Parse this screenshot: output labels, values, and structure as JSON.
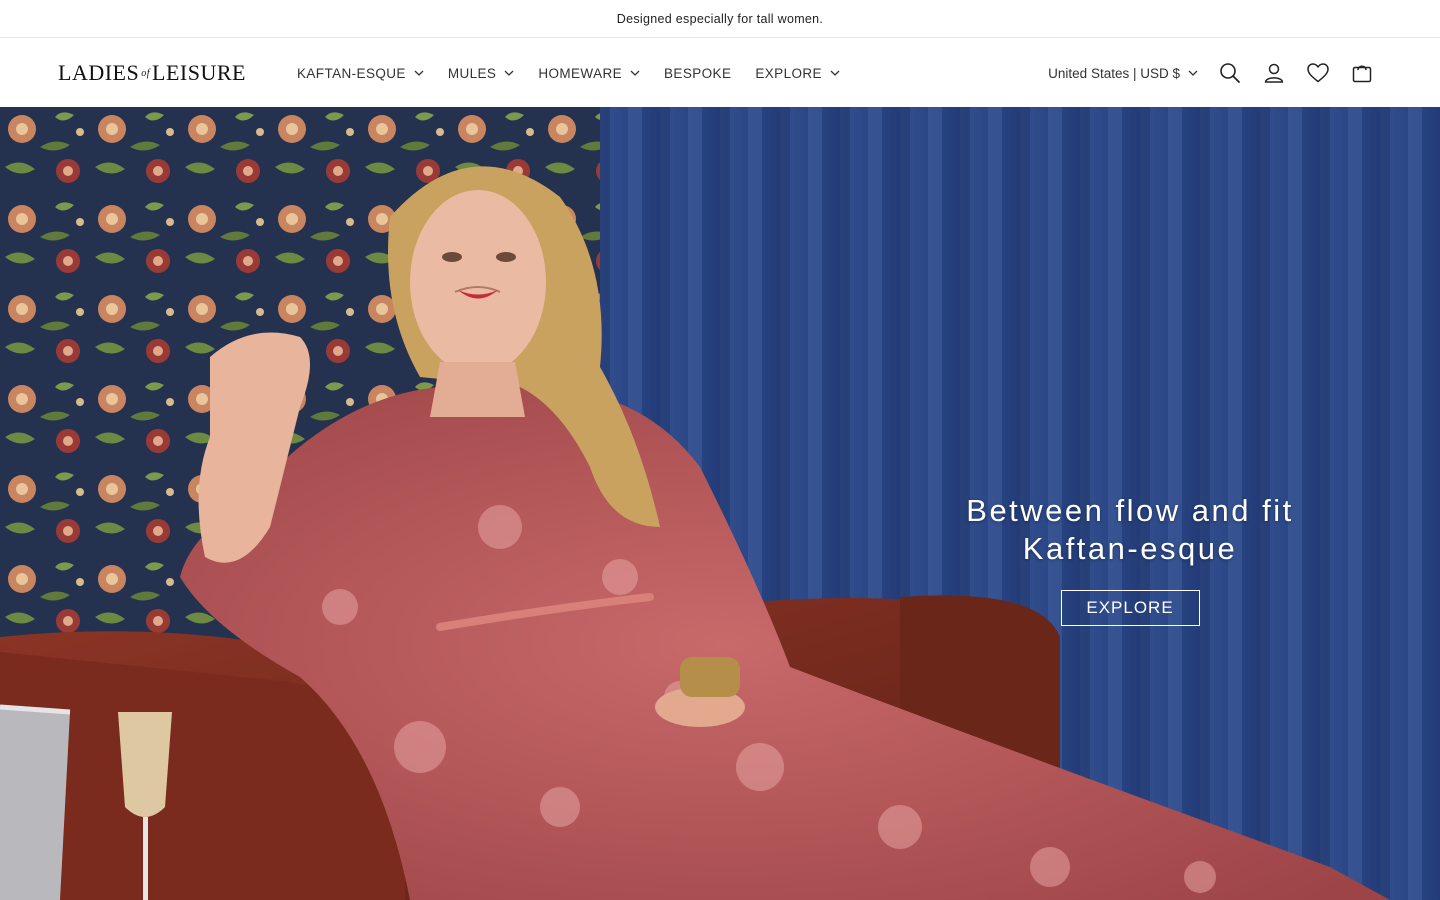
{
  "announcement": {
    "text": "Designed especially for tall women."
  },
  "header": {
    "logo": {
      "left": "LADIES",
      "middle": "of",
      "right": "LEISURE"
    },
    "nav": [
      {
        "label": "KAFTAN-ESQUE",
        "has_dropdown": true
      },
      {
        "label": "MULES",
        "has_dropdown": true
      },
      {
        "label": "HOMEWARE",
        "has_dropdown": true
      },
      {
        "label": "BESPOKE",
        "has_dropdown": false
      },
      {
        "label": "EXPLORE",
        "has_dropdown": true
      }
    ],
    "country_selector": {
      "label": "United States | USD $"
    },
    "icons": [
      "search-icon",
      "account-icon",
      "wishlist-heart-icon",
      "cart-bag-icon"
    ]
  },
  "hero": {
    "heading_line1": "Between flow and fit",
    "heading_line2": "Kaftan-esque",
    "button_label": "EXPLORE",
    "image_description_colors": {
      "curtain": "#2f4a8a",
      "wallpaper": "#25324f",
      "dress": "#b75a5c",
      "sofa": "#7a2b1e"
    }
  }
}
